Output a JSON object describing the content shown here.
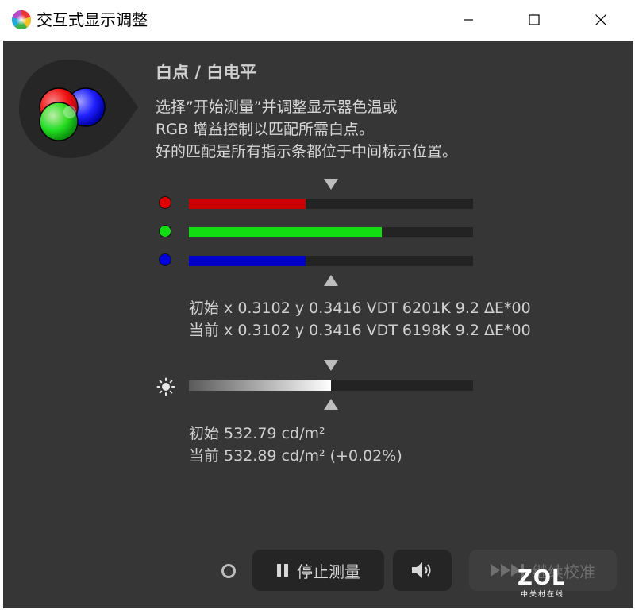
{
  "window": {
    "title": "交互式显示调整",
    "app_icon": "color-wheel-icon",
    "controls": [
      "minimize-icon",
      "maximize-icon",
      "close-icon"
    ]
  },
  "main": {
    "heading": "白点 / 白电平",
    "description": [
      "选择”开始测量”并调整显示器色温或",
      "RGB 增益控制以匹配所需白点。",
      "好的匹配是所有指示条都位于中间标示位置。"
    ]
  },
  "rgb_bars": [
    {
      "name": "red",
      "color": "#cc0000",
      "level": 0.41
    },
    {
      "name": "green",
      "color": "#11dd11",
      "level": 0.68
    },
    {
      "name": "blue",
      "color": "#0000cc",
      "level": 0.41
    }
  ],
  "rgb_readout": {
    "initial": "初始 x 0.3102 y 0.3416 VDT 6201K 9.2 ΔE*00",
    "current": "当前 x 0.3102 y 0.3416 VDT 6198K 9.2 ΔE*00"
  },
  "luminance_bar": {
    "icon": "brightness-icon",
    "level": 0.5
  },
  "luminance_readout": {
    "initial": "初始 532.79 cd/m²",
    "current": "当前 532.89 cd/m² (+0.02%)"
  },
  "footer": {
    "stop_label": "停止测量",
    "continue_label": "继续校准",
    "sound_icon": "speaker-icon"
  },
  "watermark": {
    "brand": "ZOL",
    "tagline": "中关村在线"
  },
  "colors": {
    "panel_bg": "#363636",
    "track_bg": "#232323",
    "button_bg": "#252525"
  }
}
